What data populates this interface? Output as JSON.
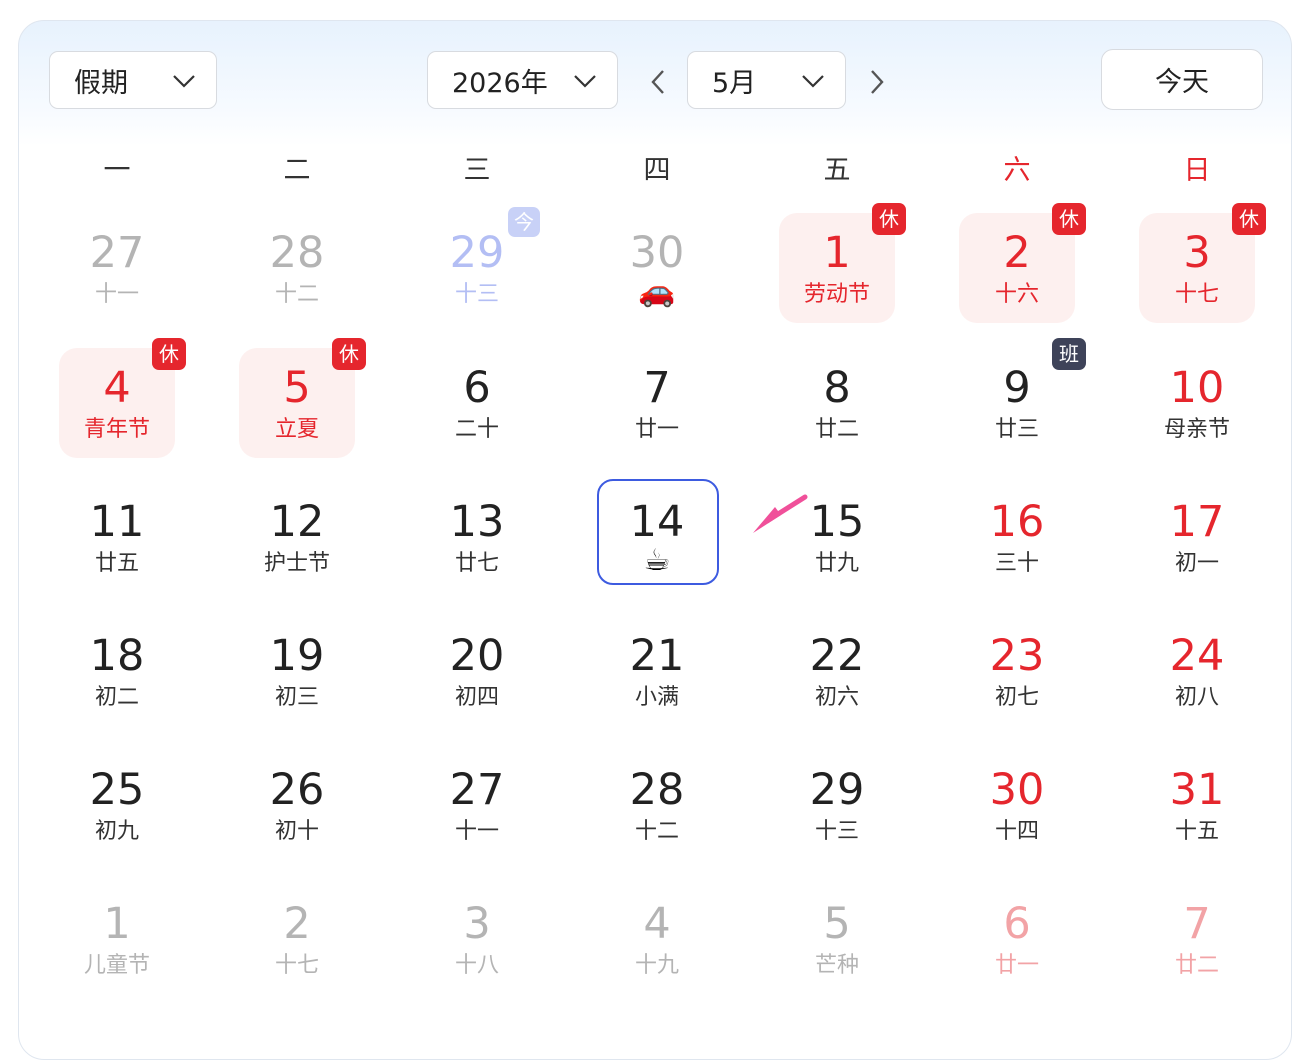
{
  "toolbar": {
    "holiday_select": "假期",
    "year_select": "2026年",
    "month_select": "5月",
    "today_button": "今天"
  },
  "weekdays": [
    "一",
    "二",
    "三",
    "四",
    "五",
    "六",
    "日"
  ],
  "colors": {
    "holiday_red": "#e5262d",
    "selected_border": "#3d5be0",
    "arrow_pink": "#f0509a"
  },
  "days": [
    {
      "num": "27",
      "sub": "十一",
      "style": "fade"
    },
    {
      "num": "28",
      "sub": "十二",
      "style": "fade"
    },
    {
      "num": "29",
      "sub": "十三",
      "style": "fadeblue",
      "badge": "今",
      "badge_type": "jin"
    },
    {
      "num": "30",
      "sub": "",
      "style": "fade",
      "emoji": "🚗",
      "icon": "car-icon"
    },
    {
      "num": "1",
      "sub": "劳动节",
      "style": "red",
      "hol": true,
      "badge": "休",
      "badge_type": "xiu"
    },
    {
      "num": "2",
      "sub": "十六",
      "style": "red",
      "hol": true,
      "badge": "休",
      "badge_type": "xiu"
    },
    {
      "num": "3",
      "sub": "十七",
      "style": "red",
      "hol": true,
      "badge": "休",
      "badge_type": "xiu"
    },
    {
      "num": "4",
      "sub": "青年节",
      "style": "red",
      "hol": true,
      "badge": "休",
      "badge_type": "xiu"
    },
    {
      "num": "5",
      "sub": "立夏",
      "style": "red",
      "hol": true,
      "badge": "休",
      "badge_type": "xiu"
    },
    {
      "num": "6",
      "sub": "二十",
      "style": ""
    },
    {
      "num": "7",
      "sub": "廿一",
      "style": ""
    },
    {
      "num": "8",
      "sub": "廿二",
      "style": ""
    },
    {
      "num": "9",
      "sub": "廿三",
      "style": "",
      "badge": "班",
      "badge_type": "ban"
    },
    {
      "num": "10",
      "sub": "母亲节",
      "style": "red-num"
    },
    {
      "num": "11",
      "sub": "廿五",
      "style": ""
    },
    {
      "num": "12",
      "sub": "护士节",
      "style": ""
    },
    {
      "num": "13",
      "sub": "廿七",
      "style": ""
    },
    {
      "num": "14",
      "sub": "",
      "style": "",
      "selected": true,
      "emoji": "☕",
      "icon": "coffee-icon"
    },
    {
      "num": "15",
      "sub": "廿九",
      "style": ""
    },
    {
      "num": "16",
      "sub": "三十",
      "style": "red-num"
    },
    {
      "num": "17",
      "sub": "初一",
      "style": "red-num"
    },
    {
      "num": "18",
      "sub": "初二",
      "style": ""
    },
    {
      "num": "19",
      "sub": "初三",
      "style": ""
    },
    {
      "num": "20",
      "sub": "初四",
      "style": ""
    },
    {
      "num": "21",
      "sub": "小满",
      "style": ""
    },
    {
      "num": "22",
      "sub": "初六",
      "style": ""
    },
    {
      "num": "23",
      "sub": "初七",
      "style": "red-num"
    },
    {
      "num": "24",
      "sub": "初八",
      "style": "red-num"
    },
    {
      "num": "25",
      "sub": "初九",
      "style": ""
    },
    {
      "num": "26",
      "sub": "初十",
      "style": ""
    },
    {
      "num": "27",
      "sub": "十一",
      "style": ""
    },
    {
      "num": "28",
      "sub": "十二",
      "style": ""
    },
    {
      "num": "29",
      "sub": "十三",
      "style": ""
    },
    {
      "num": "30",
      "sub": "十四",
      "style": "red-num"
    },
    {
      "num": "31",
      "sub": "十五",
      "style": "red-num"
    },
    {
      "num": "1",
      "sub": "儿童节",
      "style": "fade"
    },
    {
      "num": "2",
      "sub": "十七",
      "style": "fade"
    },
    {
      "num": "3",
      "sub": "十八",
      "style": "fade"
    },
    {
      "num": "4",
      "sub": "十九",
      "style": "fade"
    },
    {
      "num": "5",
      "sub": "芒种",
      "style": "fade"
    },
    {
      "num": "6",
      "sub": "廿一",
      "style": "fadered"
    },
    {
      "num": "7",
      "sub": "廿二",
      "style": "fadered"
    }
  ]
}
